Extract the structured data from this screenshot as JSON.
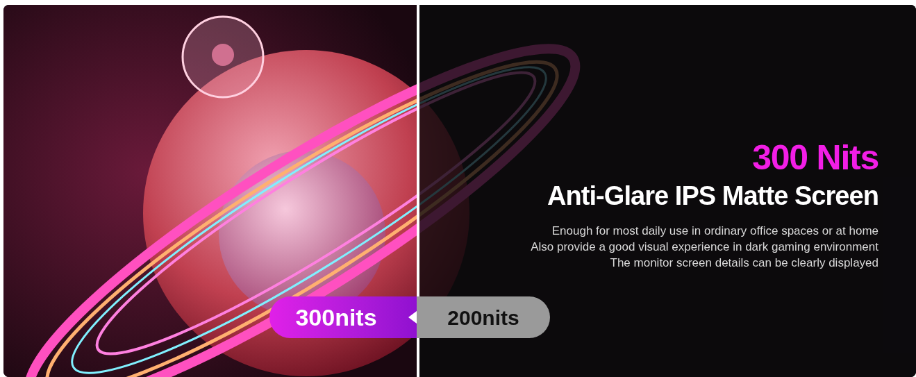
{
  "banner": {
    "headline": "300 Nits",
    "title": "Anti-Glare IPS Matte Screen",
    "description": [
      "Enough for most daily use in ordinary office spaces or at home",
      "Also provide a good visual experience in dark gaming environment",
      "The monitor screen details can be clearly displayed"
    ],
    "comparison": [
      {
        "label": "300nits",
        "kind": "bright"
      },
      {
        "label": "200nits",
        "kind": "dim"
      }
    ]
  }
}
